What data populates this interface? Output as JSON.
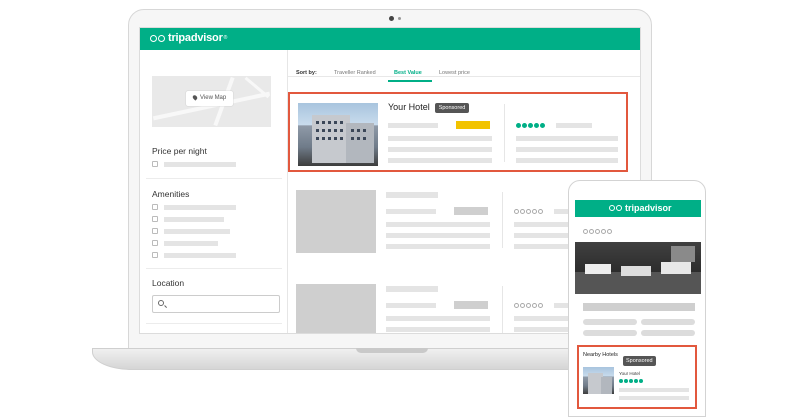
{
  "brand": {
    "name": "tripadvisor",
    "accent": "#00af87",
    "highlight": "#e2583e"
  },
  "sidebar": {
    "map_button": "View Map",
    "price_heading": "Price per night",
    "amenities_heading": "Amenities",
    "location_heading": "Location"
  },
  "sort": {
    "label": "Sort by:",
    "options": [
      "Traveller Ranked",
      "Best Value",
      "Lowest price"
    ],
    "active": "Best Value"
  },
  "featured": {
    "title": "Your Hotel",
    "badge": "Sponsored"
  },
  "phone": {
    "section_title": "Nearby Hotels",
    "badge": "Sponsored",
    "hotel_name": "Your Hotel"
  },
  "icons": [
    "owl-logo-icon",
    "map-pin-icon",
    "search-icon",
    "rating-bubbles-icon",
    "checkbox-icon"
  ]
}
